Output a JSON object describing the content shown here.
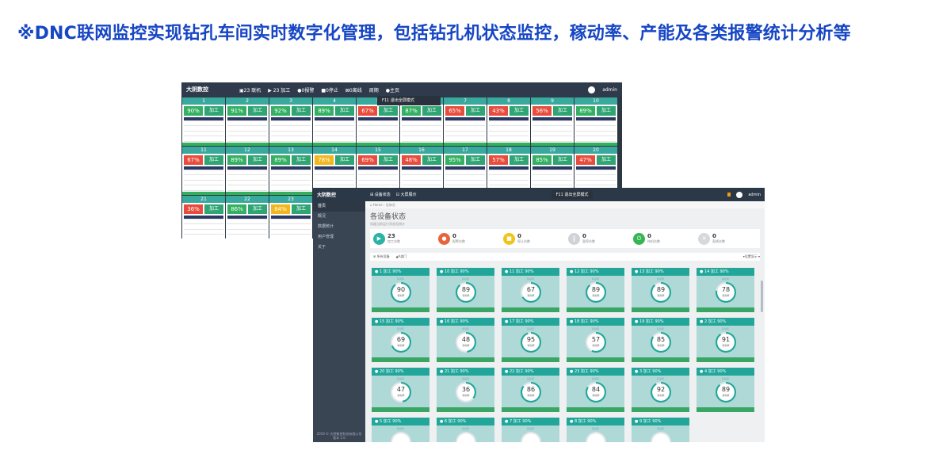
{
  "headline": "※DNC联网监控实现钻孔车间实时数字化管理，包括钻孔机状态监控，稼动率、产能及各类报警统计分析等",
  "back_screen": {
    "brand": "大阴数控",
    "nav": [
      "▣23 联机",
      "▶ 23 加工",
      "●0报警",
      "■0停止",
      "⊠0离线",
      "周期",
      "●主页"
    ],
    "user": "admin",
    "mode_label": "F11 退出全屏模式",
    "machines": [
      {
        "id": "1",
        "pct": "90%",
        "state": "加工",
        "color": "green"
      },
      {
        "id": "2",
        "pct": "91%",
        "state": "加工",
        "color": "green"
      },
      {
        "id": "3",
        "pct": "92%",
        "state": "加工",
        "color": "green"
      },
      {
        "id": "4",
        "pct": "89%",
        "state": "加工",
        "color": "green"
      },
      {
        "id": "5",
        "pct": "67%",
        "state": "加工",
        "color": "red"
      },
      {
        "id": "6",
        "pct": "87%",
        "state": "加工",
        "color": "green"
      },
      {
        "id": "7",
        "pct": "65%",
        "state": "加工",
        "color": "red"
      },
      {
        "id": "8",
        "pct": "43%",
        "state": "加工",
        "color": "red"
      },
      {
        "id": "9",
        "pct": "56%",
        "state": "加工",
        "color": "red"
      },
      {
        "id": "10",
        "pct": "89%",
        "state": "加工",
        "color": "green"
      },
      {
        "id": "11",
        "pct": "67%",
        "state": "加工",
        "color": "red"
      },
      {
        "id": "12",
        "pct": "89%",
        "state": "加工",
        "color": "green"
      },
      {
        "id": "13",
        "pct": "89%",
        "state": "加工",
        "color": "green"
      },
      {
        "id": "14",
        "pct": "78%",
        "state": "加工",
        "color": "yellow"
      },
      {
        "id": "15",
        "pct": "69%",
        "state": "加工",
        "color": "red"
      },
      {
        "id": "16",
        "pct": "48%",
        "state": "加工",
        "color": "red"
      },
      {
        "id": "17",
        "pct": "95%",
        "state": "加工",
        "color": "green"
      },
      {
        "id": "18",
        "pct": "57%",
        "state": "加工",
        "color": "red"
      },
      {
        "id": "19",
        "pct": "85%",
        "state": "加工",
        "color": "green"
      },
      {
        "id": "20",
        "pct": "47%",
        "state": "加工",
        "color": "red"
      },
      {
        "id": "21",
        "pct": "36%",
        "state": "加工",
        "color": "red"
      },
      {
        "id": "22",
        "pct": "86%",
        "state": "加工",
        "color": "green"
      },
      {
        "id": "23",
        "pct": "84%",
        "state": "加工",
        "color": "yellow"
      }
    ]
  },
  "front_screen": {
    "brand": "大阴数控",
    "tabs": [
      "⊞ 设备状态",
      "⊡ 大屏展示"
    ],
    "mode_label": "F11 退出全屏模式",
    "user": "admin",
    "sidebar": [
      "首页",
      "概况",
      "数据统计",
      "用户管理",
      "关于"
    ],
    "sidebar_footer": "2019 © 大阴数控科技有限公司 版本 1.0",
    "breadcrumb": "⌂ Home › 总体况",
    "page_title": "各设备状态",
    "page_sub": "机器当前运行状态及统计",
    "stats": [
      {
        "value": "23",
        "label": "加工台数",
        "color": "#2bb3a6",
        "icon": "▶"
      },
      {
        "value": "0",
        "label": "报警台数",
        "color": "#e8643c",
        "icon": "●"
      },
      {
        "value": "0",
        "label": "停止台数",
        "color": "#f0c419",
        "icon": "■"
      },
      {
        "value": "0",
        "label": "暂停台数",
        "color": "#cfd3d7",
        "icon": "‖"
      },
      {
        "value": "0",
        "label": "待机台数",
        "color": "#36b552",
        "icon": "⏻"
      },
      {
        "value": "0",
        "label": "离线台数",
        "color": "#d6d9dc",
        "icon": "✕"
      }
    ],
    "filter_left": "⊞ 所有设备",
    "filter_mid": "▲A部门",
    "filter_right": "▾设置显示 ▾",
    "tiles": [
      {
        "id": "1",
        "state": "加工",
        "rate": "90%",
        "value": "90"
      },
      {
        "id": "10",
        "state": "加工",
        "rate": "90%",
        "value": "89"
      },
      {
        "id": "11",
        "state": "加工",
        "rate": "90%",
        "value": "67"
      },
      {
        "id": "12",
        "state": "加工",
        "rate": "90%",
        "value": "89"
      },
      {
        "id": "13",
        "state": "加工",
        "rate": "90%",
        "value": "89"
      },
      {
        "id": "14",
        "state": "加工",
        "rate": "90%",
        "value": "78"
      },
      {
        "id": "15",
        "state": "加工",
        "rate": "90%",
        "value": "69"
      },
      {
        "id": "16",
        "state": "加工",
        "rate": "90%",
        "value": "48"
      },
      {
        "id": "17",
        "state": "加工",
        "rate": "90%",
        "value": "95"
      },
      {
        "id": "18",
        "state": "加工",
        "rate": "90%",
        "value": "57"
      },
      {
        "id": "19",
        "state": "加工",
        "rate": "90%",
        "value": "85"
      },
      {
        "id": "2",
        "state": "加工",
        "rate": "90%",
        "value": "91"
      },
      {
        "id": "20",
        "state": "加工",
        "rate": "90%",
        "value": "47"
      },
      {
        "id": "21",
        "state": "加工",
        "rate": "90%",
        "value": "36"
      },
      {
        "id": "22",
        "state": "加工",
        "rate": "90%",
        "value": "86"
      },
      {
        "id": "23",
        "state": "加工",
        "rate": "90%",
        "value": "84"
      },
      {
        "id": "3",
        "state": "加工",
        "rate": "90%",
        "value": "92"
      },
      {
        "id": "4",
        "state": "加工",
        "rate": "90%",
        "value": "89"
      },
      {
        "id": "5",
        "state": "加工",
        "rate": "90%",
        "value": ""
      },
      {
        "id": "6",
        "state": "加工",
        "rate": "90%",
        "value": ""
      },
      {
        "id": "7",
        "state": "加工",
        "rate": "90%",
        "value": ""
      },
      {
        "id": "8",
        "state": "加工",
        "rate": "90%",
        "value": ""
      },
      {
        "id": "9",
        "state": "加工",
        "rate": "90%",
        "value": ""
      }
    ],
    "rate_label": "稼动率"
  }
}
